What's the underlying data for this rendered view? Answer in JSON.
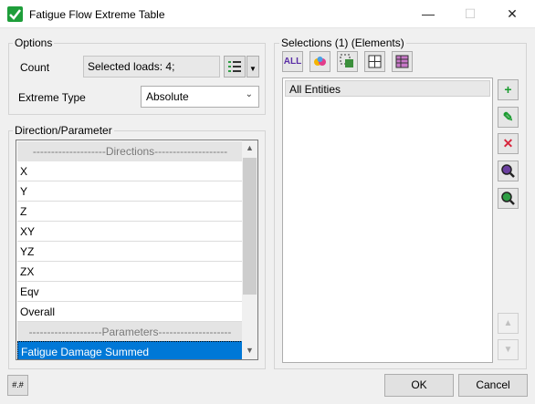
{
  "window": {
    "title": "Fatigue Flow Extreme Table",
    "minimize": "—",
    "maximize": "☐",
    "close": "✕"
  },
  "options": {
    "group_label": "Options",
    "count_label": "Count",
    "count_value": "Selected loads: 4;",
    "extreme_type_label": "Extreme Type",
    "extreme_type_value": "Absolute"
  },
  "direction": {
    "group_label": "Direction/Parameter",
    "rows": [
      {
        "label": "--------------------Directions--------------------",
        "type": "header"
      },
      {
        "label": "X",
        "type": "item"
      },
      {
        "label": "Y",
        "type": "item"
      },
      {
        "label": "Z",
        "type": "item"
      },
      {
        "label": "XY",
        "type": "item"
      },
      {
        "label": "YZ",
        "type": "item"
      },
      {
        "label": "ZX",
        "type": "item"
      },
      {
        "label": "Eqv",
        "type": "item"
      },
      {
        "label": "Overall",
        "type": "item"
      },
      {
        "label": "--------------------Parameters--------------------",
        "type": "header"
      },
      {
        "label": "Fatigue Damage Summed",
        "type": "selected"
      }
    ]
  },
  "selections": {
    "group_label": "Selections (1) (Elements)",
    "toolbar": [
      "ALL",
      "colors-icon",
      "select-tree-icon",
      "grid-icon",
      "table-icon"
    ],
    "all_label": "ALL",
    "items": [
      "All Entities"
    ]
  },
  "side_buttons": {
    "add": "+",
    "edit": "✎",
    "delete": "✕",
    "zoom1": "🔍",
    "zoom2": "🔍",
    "up": "▲",
    "down": "▼"
  },
  "footer": {
    "ok": "OK",
    "cancel": "Cancel",
    "small": "#.#"
  },
  "colors": {
    "accent": "#0078d7",
    "add_green": "#1a9b2f",
    "delete_red": "#d7263d"
  }
}
